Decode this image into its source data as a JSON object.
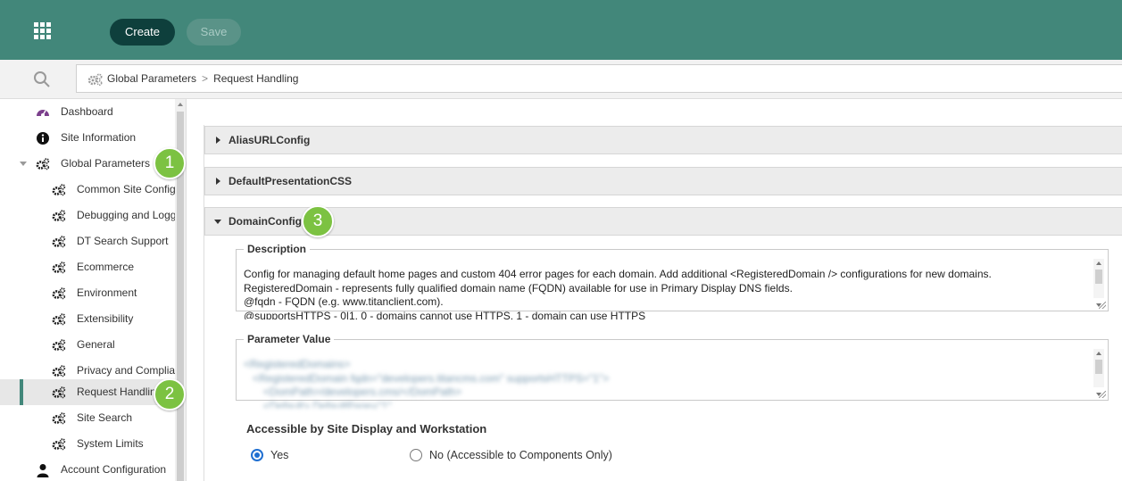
{
  "toolbar": {
    "create_label": "Create",
    "save_label": "Save"
  },
  "breadcrumb": {
    "root": "Global Parameters",
    "separator": ">",
    "current": "Request Handling"
  },
  "sidebar": {
    "items": [
      {
        "label": "Dashboard",
        "icon": "dashboard-gauge-icon"
      },
      {
        "label": "Site Information",
        "icon": "info-icon"
      },
      {
        "label": "Global Parameters",
        "icon": "gears-icon"
      },
      {
        "label": "Common Site Config",
        "icon": "gears-icon"
      },
      {
        "label": "Debugging and Logging",
        "icon": "gears-icon"
      },
      {
        "label": "DT Search Support",
        "icon": "gears-icon"
      },
      {
        "label": "Ecommerce",
        "icon": "gears-icon"
      },
      {
        "label": "Environment",
        "icon": "gears-icon"
      },
      {
        "label": "Extensibility",
        "icon": "gears-icon"
      },
      {
        "label": "General",
        "icon": "gears-icon"
      },
      {
        "label": "Privacy and Compliance",
        "icon": "gears-icon"
      },
      {
        "label": "Request Handling",
        "icon": "gears-icon"
      },
      {
        "label": "Site Search",
        "icon": "gears-icon"
      },
      {
        "label": "System Limits",
        "icon": "gears-icon"
      },
      {
        "label": "Account Configuration",
        "icon": "user-icon"
      }
    ]
  },
  "callouts": {
    "one": "1",
    "two": "2",
    "three": "3"
  },
  "sections": {
    "alias": "AliasURLConfig",
    "css": "DefaultPresentationCSS",
    "domain": "DomainConfig"
  },
  "domain_config": {
    "description_legend": "Description",
    "description_lines": [
      "Config for managing default home pages and custom 404 error pages for each domain. Add additional <RegisteredDomain /> configurations for new domains.",
      "RegisteredDomain - represents fully qualified domain name (FQDN) available for use in Primary Display DNS fields.",
      "@fqdn - FQDN (e.g. www.titanclient.com).",
      "@supportsHTTPS - 0|1. 0 - domains cannot use HTTPS, 1 - domain can use HTTPS"
    ],
    "parameter_legend": "Parameter Value",
    "parameter_lines": [
      "<RegisteredDomains>",
      "<RegisteredDomain fqdn=\"developers.titancms.com\" supportsHTTPS=\"1\">",
      "<DomPath>/developers.cms/</DomPath>",
      "<Default> DefaultPage=\"1\""
    ],
    "access_label": "Accessible by Site Display and Workstation",
    "option_yes": "Yes",
    "option_no": "No (Accessible to Components Only)"
  },
  "colors": {
    "header": "#42877a",
    "create_button": "#0e3f3c",
    "callout": "#7cc242",
    "radio": "#1f6fd1"
  }
}
